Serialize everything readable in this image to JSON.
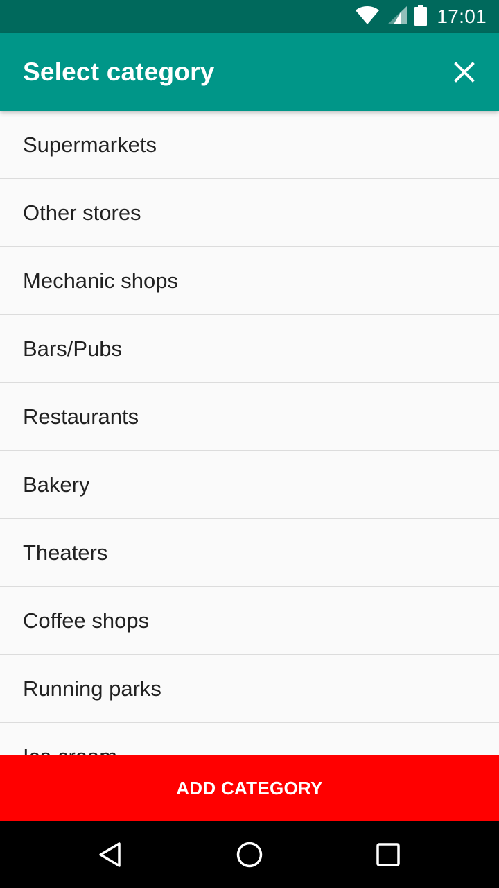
{
  "status_bar": {
    "time": "17:01",
    "icons": [
      "wifi-icon",
      "signal-icon",
      "battery-icon"
    ]
  },
  "app_bar": {
    "title": "Select category",
    "close_icon": "close-icon",
    "color": "#009688"
  },
  "categories": [
    "Supermarkets",
    "Other stores",
    "Mechanic shops",
    "Bars/Pubs",
    "Restaurants",
    "Bakery",
    "Theaters",
    "Coffee shops",
    "Running parks",
    "Ice cream"
  ],
  "add_button": {
    "label": "ADD CATEGORY",
    "color": "#ff0000"
  },
  "nav_bar": {
    "icons": [
      "back-icon",
      "home-icon",
      "recents-icon"
    ]
  }
}
